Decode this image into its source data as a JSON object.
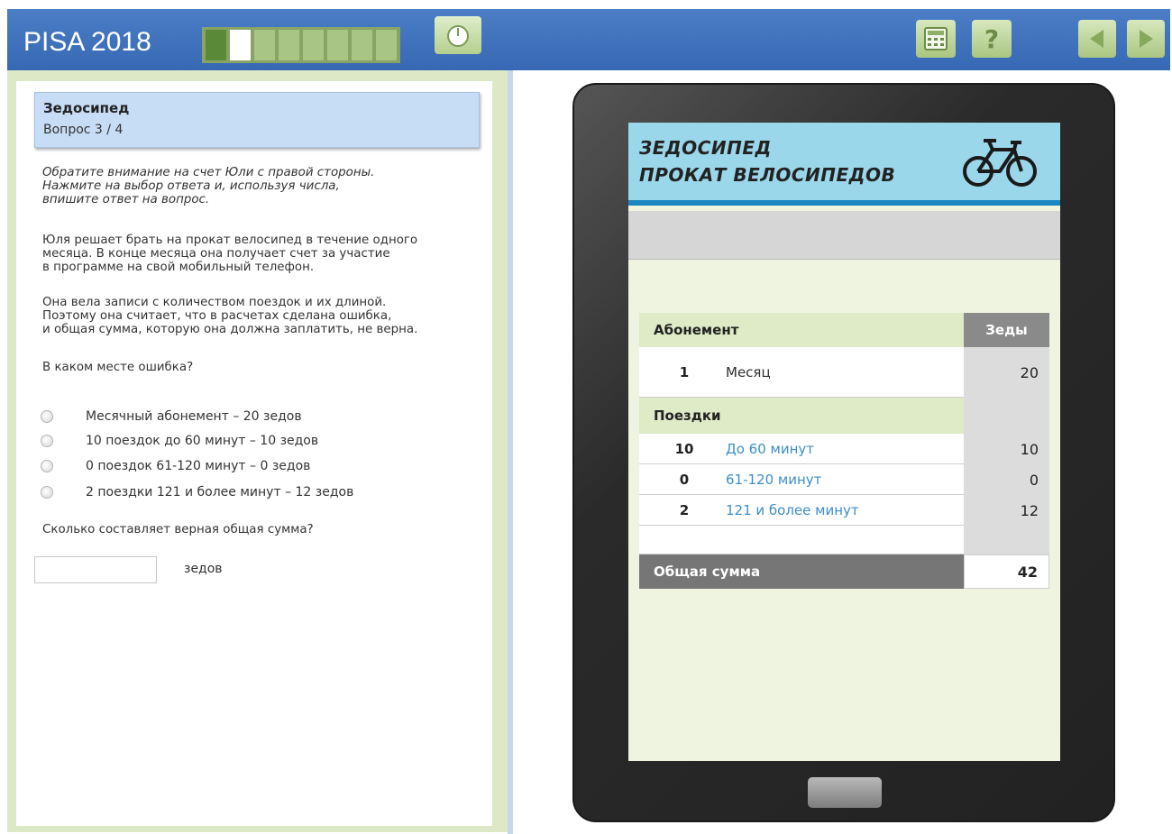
{
  "app": {
    "title": "PISA 2018"
  },
  "progress": {
    "total_segments": 8,
    "completed": 1,
    "current": 2
  },
  "toolbar": {
    "icons": {
      "timer": "timer-icon",
      "calculator": "calculator-icon",
      "help": "help-icon",
      "back": "back-arrow-icon",
      "forward": "forward-arrow-icon"
    },
    "help_glyph": "?"
  },
  "question": {
    "title": "Зедосипед",
    "number": "Вопрос 3 / 4",
    "instructions": [
      "Обратите внимание на счет Юли с правой стороны.",
      "Нажмите на выбор ответа и, используя числа,",
      "впишите ответ на вопрос."
    ],
    "paragraph1": [
      "Юля решает брать на прокат велосипед в течение одного",
      "месяца. В конце месяца она получает счет за участие",
      "в программе на свой мобильный телефон."
    ],
    "paragraph2": [
      "Она вела записи с количеством поездок и их длиной.",
      "Поэтому она считает, что в расчетах сделана ошибка,",
      "и общая сумма, которую она должна заплатить, не верна."
    ],
    "prompt": "В каком месте ошибка?",
    "options": [
      "Месячный абонемент – 20 зедов",
      "10 поездок до 60 минут – 10 зедов",
      "0 поездок 61-120 минут – 0 зедов",
      "2 поездки 121 и более минут – 12 зедов"
    ],
    "total_prompt": "Сколько составляет верная общая сумма?",
    "answer_value": "",
    "answer_unit": "зедов"
  },
  "tablet": {
    "header_line1": "ЗЕДОСИПЕД",
    "header_line2": "ПРОКАТ ВЕЛОСИПЕДОВ",
    "header_icon": "bicycle-icon",
    "bill": {
      "subscription_label": "Абонемент",
      "currency_label": "Зеды",
      "subscription_qty": "1",
      "subscription_desc": "Месяц",
      "subscription_value": "20",
      "trips_label": "Поездки",
      "trips": [
        {
          "qty": "10",
          "desc": "До 60 минут",
          "value": "10"
        },
        {
          "qty": "0",
          "desc": "61-120 минут",
          "value": "0"
        },
        {
          "qty": "2",
          "desc": "121 и более минут",
          "value": "12"
        }
      ],
      "total_label": "Общая сумма",
      "total_value": "42"
    }
  }
}
